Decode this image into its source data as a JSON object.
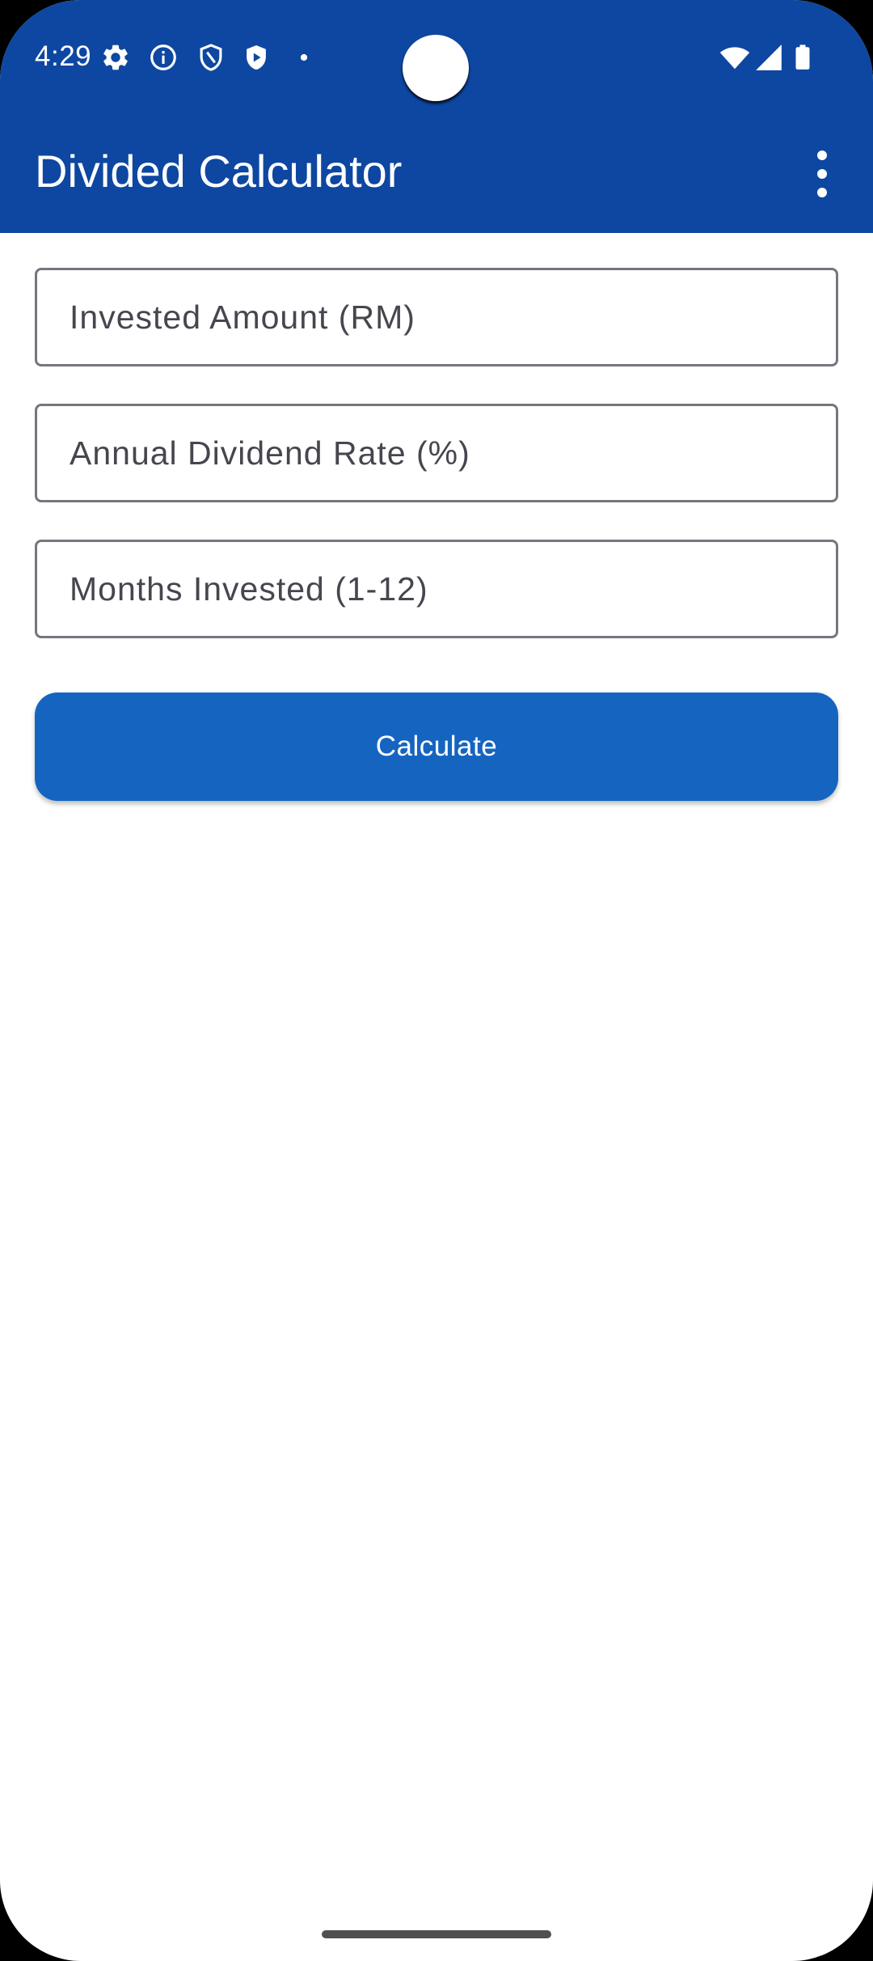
{
  "status_bar": {
    "time": "4:29",
    "icons": [
      "settings-icon",
      "info-icon",
      "shield-icon",
      "play-shield-icon",
      "notification-dot-icon",
      "wifi-icon",
      "signal-icon",
      "battery-icon"
    ],
    "background": "#0d47a1"
  },
  "app_bar": {
    "title": "Divided Calculator",
    "overflow_icon": "more-vert-icon",
    "background": "#0d47a1"
  },
  "form": {
    "invested_amount": {
      "value": "",
      "placeholder": "Invested Amount (RM)"
    },
    "dividend_rate": {
      "value": "",
      "placeholder": "Annual Dividend Rate (%)"
    },
    "months_invested": {
      "value": "",
      "placeholder": "Months Invested (1-12)"
    }
  },
  "actions": {
    "calculate_label": "Calculate",
    "accent": "#1565c0"
  }
}
